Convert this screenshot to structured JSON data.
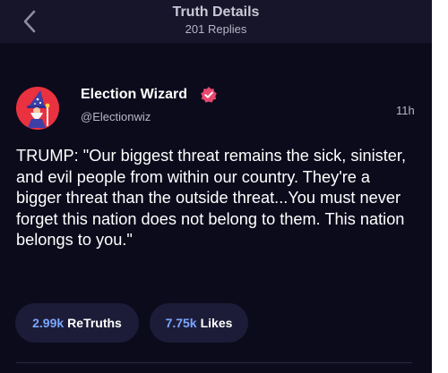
{
  "header": {
    "title": "Truth Details",
    "subtitle": "201 Replies"
  },
  "post": {
    "author_name": "Election Wizard",
    "handle": "@Electionwiz",
    "time": "11h",
    "verified": true,
    "text": "TRUMP: \"Our biggest threat remains the sick, sinister, and evil people from within our country. They're a bigger threat than the outside threat...You must never forget this nation does not belong to them. This nation belongs to you.\""
  },
  "stats": {
    "retruths_count": "2.99k",
    "retruths_label": "ReTruths",
    "likes_count": "7.75k",
    "likes_label": "Likes"
  },
  "colors": {
    "background": "#0c0b1c",
    "header_bg": "#16152a",
    "accent_blue": "#7aa7ff",
    "verified_pink": "#e8476f",
    "avatar_red": "#e9313f"
  },
  "icons": {
    "back": "chevron-left-icon",
    "verified": "verified-badge-icon"
  }
}
